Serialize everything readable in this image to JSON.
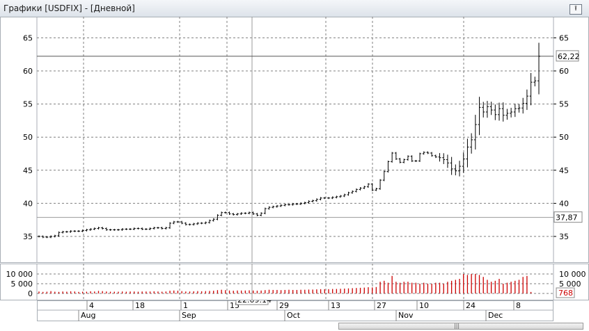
{
  "window": {
    "title": "Графики [USDFIX] - [Дневной]",
    "pin_icon": "pin-icon"
  },
  "price_axis": {
    "ticks": [
      "65",
      "60",
      "55",
      "50",
      "45",
      "40",
      "35"
    ],
    "last_label": "62,22",
    "cursor_label": "37,87"
  },
  "volume_axis": {
    "ticks": [
      "10 000",
      "5 000",
      "0"
    ],
    "last_label": "768"
  },
  "time_axis": {
    "days": [
      "4",
      "18",
      "1",
      "15",
      "29",
      "13",
      "27",
      "10",
      "24",
      "8"
    ],
    "months": [
      "Aug",
      "Sep",
      "Oct",
      "Nov",
      "Dec"
    ],
    "cursor_date": "22.09.14"
  },
  "colors": {
    "candle": "#000000",
    "volume": "#cc0000",
    "grid": "#7f7f7f",
    "accent_label": "#cc0000"
  },
  "chart_data": [
    {
      "type": "line",
      "series": [
        {
          "values": [
            35,
            34.9,
            34.9,
            35,
            35.1,
            35.6,
            35.7,
            35.7,
            35.8,
            35.8,
            35.8,
            35.9,
            36,
            36.1,
            36.2,
            36.3,
            36.2,
            36,
            36,
            36,
            36,
            36.1,
            36.1,
            36.1,
            36.2,
            36.2,
            36.1,
            36.1,
            36.2,
            36.3,
            36.3,
            36.2,
            36.3,
            37,
            37.2,
            37.2,
            37,
            36.8,
            36.8,
            36.9,
            37,
            37,
            37.1,
            37.4,
            37.6,
            38.2,
            38.6,
            38.6,
            38.4,
            38.3,
            38.4,
            38.5,
            38.5,
            38.6,
            38.4,
            38.2,
            38.5,
            39.2,
            39.4,
            39.5,
            39.6,
            39.7,
            39.8,
            39.8,
            39.9,
            39.9,
            40,
            40.1,
            40.3,
            40.4,
            40.6,
            40.8,
            40.8,
            40.8,
            40.9,
            41,
            41.1,
            41.3,
            41.6,
            41.8,
            42.1,
            42.3,
            42.5,
            42.9,
            42,
            42.2,
            43.5,
            44.8,
            46.3,
            47.6,
            46.7,
            46.2,
            46.6,
            47.1,
            46.4,
            46.4,
            47.5,
            47.7,
            47.6,
            47.2,
            47,
            46.9,
            46.6,
            46.1,
            45.2,
            44.9,
            45.6,
            46.7,
            48.5,
            49.6,
            51.9,
            54.5,
            53.8,
            54.6,
            54.1,
            53.4,
            54.3,
            53.3,
            53.6,
            53.8,
            54.3,
            54.4,
            55.1,
            56.2,
            58.3,
            58.5,
            62.22
          ]
        }
      ],
      "ylim": [
        33,
        67
      ],
      "grid": true
    },
    {
      "type": "bar",
      "series": [
        {
          "values": [
            1000,
            800,
            900,
            1200,
            900,
            800,
            1000,
            900,
            1100,
            1000,
            800,
            900,
            900,
            1100,
            1000,
            1300,
            1200,
            1000,
            900,
            900,
            900,
            1000,
            900,
            1000,
            1000,
            900,
            1000,
            1000,
            1000,
            1100,
            1000,
            900,
            1000,
            1400,
            1500,
            1400,
            1200,
            1000,
            1000,
            1100,
            1200,
            1100,
            1200,
            1300,
            1400,
            1700,
            1900,
            1700,
            1500,
            1400,
            1500,
            1500,
            1500,
            1600,
            1500,
            1400,
            1500,
            1700,
            1900,
            1800,
            1800,
            1700,
            1800,
            1900,
            1800,
            1800,
            1900,
            1900,
            2000,
            2000,
            2100,
            2200,
            2200,
            2200,
            2300,
            2300,
            2400,
            2500,
            2600,
            2700,
            2800,
            2900,
            3000,
            3200,
            3100,
            3300,
            6000,
            6500,
            5500,
            9000,
            6000,
            5500,
            6000,
            6000,
            5500,
            5500,
            5000,
            5500,
            5000,
            5000,
            5500,
            5500,
            5000,
            6000,
            6500,
            7000,
            7500,
            10000,
            9500,
            10000,
            10000,
            9500,
            8500,
            7000,
            6000,
            6500,
            7500,
            5000,
            5500,
            6000,
            6500,
            7000,
            8500,
            9000,
            768
          ]
        }
      ],
      "ylim": [
        0,
        12000
      ],
      "grid": true
    }
  ]
}
